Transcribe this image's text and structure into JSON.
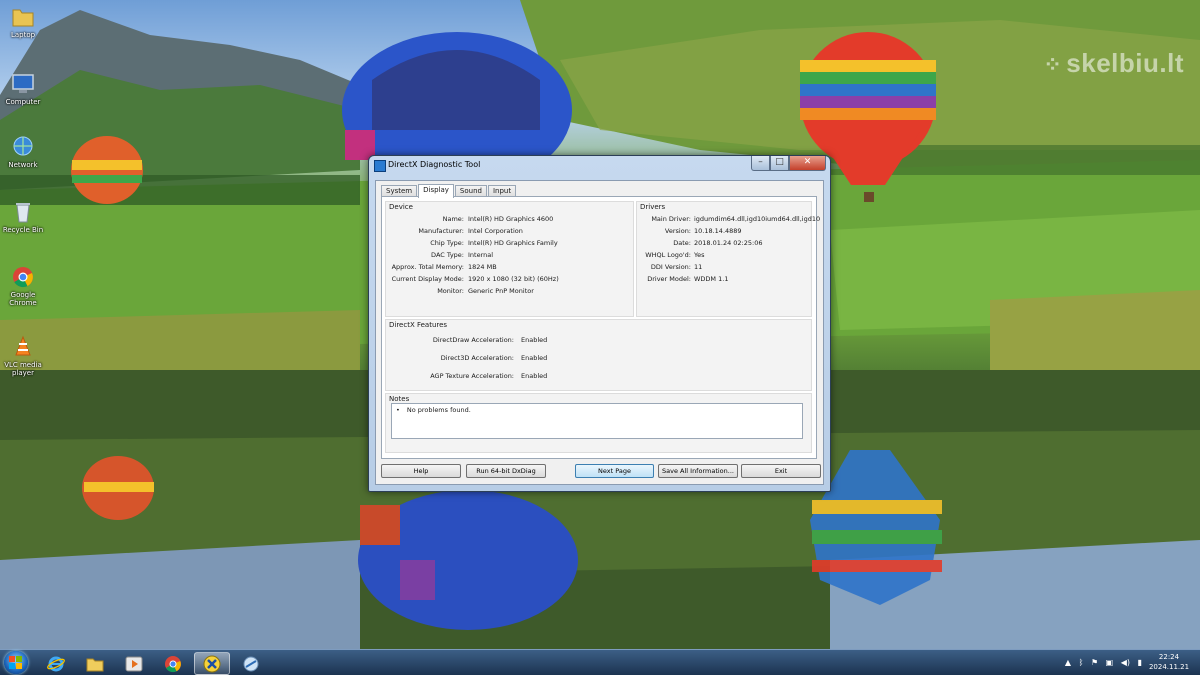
{
  "desktop": {
    "watermark": "skelbiu.lt",
    "icons": [
      {
        "label": "Laptop",
        "icon": "folder-icon"
      },
      {
        "label": "Computer",
        "icon": "computer-icon"
      },
      {
        "label": "Network",
        "icon": "network-icon"
      },
      {
        "label": "Recycle Bin",
        "icon": "recycle-bin-icon"
      },
      {
        "label": "Google Chrome",
        "icon": "chrome-icon"
      },
      {
        "label": "VLC media player",
        "icon": "vlc-icon"
      }
    ]
  },
  "window": {
    "title": "DirectX Diagnostic Tool",
    "tabs": [
      "System",
      "Display",
      "Sound",
      "Input"
    ],
    "selected_tab": "Display",
    "device": {
      "title": "Device",
      "rows": [
        {
          "key": "Name:",
          "value": "Intel(R) HD Graphics 4600"
        },
        {
          "key": "Manufacturer:",
          "value": "Intel Corporation"
        },
        {
          "key": "Chip Type:",
          "value": "Intel(R) HD Graphics Family"
        },
        {
          "key": "DAC Type:",
          "value": "Internal"
        },
        {
          "key": "Approx. Total Memory:",
          "value": "1824 MB"
        },
        {
          "key": "Current Display Mode:",
          "value": "1920 x 1080 (32 bit) (60Hz)"
        },
        {
          "key": "Monitor:",
          "value": "Generic PnP Monitor"
        }
      ]
    },
    "drivers": {
      "title": "Drivers",
      "rows": [
        {
          "key": "Main Driver:",
          "value": "igdumdim64.dll,igd10iumd64.dll,igd10"
        },
        {
          "key": "Version:",
          "value": "10.18.14.4889"
        },
        {
          "key": "Date:",
          "value": "2018.01.24 02:25:06"
        },
        {
          "key": "WHQL Logo'd:",
          "value": "Yes"
        },
        {
          "key": "DDI Version:",
          "value": "11"
        },
        {
          "key": "Driver Model:",
          "value": "WDDM 1.1"
        }
      ]
    },
    "features": {
      "title": "DirectX Features",
      "rows": [
        {
          "key": "DirectDraw Acceleration:",
          "value": "Enabled"
        },
        {
          "key": "Direct3D Acceleration:",
          "value": "Enabled"
        },
        {
          "key": "AGP Texture Acceleration:",
          "value": "Enabled"
        }
      ]
    },
    "notes": {
      "title": "Notes",
      "items": [
        "No problems found."
      ]
    },
    "buttons": {
      "help": "Help",
      "run64": "Run 64-bit DxDiag",
      "next": "Next Page",
      "save": "Save All Information...",
      "exit": "Exit"
    }
  },
  "taskbar": {
    "apps": [
      "internet-explorer-icon",
      "file-explorer-icon",
      "media-player-icon",
      "chrome-icon",
      "dxdiag-icon",
      "network-diagnostics-icon"
    ],
    "clock": {
      "time": "22:24",
      "date": "2024.11.21"
    }
  }
}
